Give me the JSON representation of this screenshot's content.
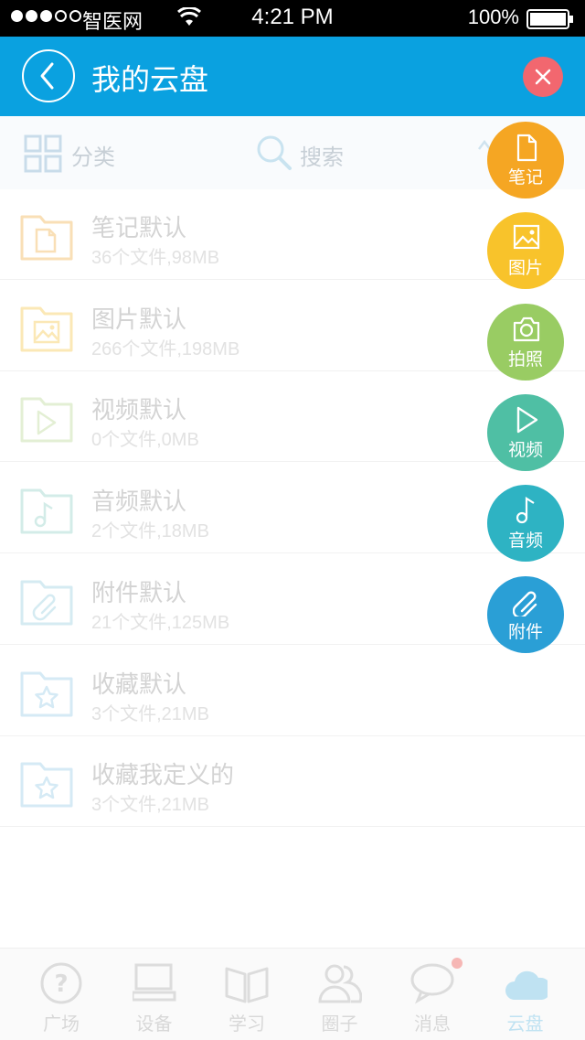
{
  "status_bar": {
    "carrier": "智医网",
    "time": "4:21 PM",
    "battery": "100%",
    "signal_bars_filled": 3,
    "signal_bars_total": 5
  },
  "header": {
    "title": "我的云盘",
    "back_icon": "chevron-left-icon",
    "close_icon": "close-icon",
    "background_color": "#0aa1e0",
    "close_color": "#f2676f"
  },
  "toolbar": {
    "category_label": "分类",
    "search_label": "搜索"
  },
  "folders": [
    {
      "name": "笔记默认",
      "meta": "36个文件,98MB",
      "icon": "note-folder-icon",
      "color": "#f9dfb6"
    },
    {
      "name": "图片默认",
      "meta": "266个文件,198MB",
      "icon": "image-folder-icon",
      "color": "#fbe8b6"
    },
    {
      "name": "视频默认",
      "meta": "0个文件,0MB",
      "icon": "video-folder-icon",
      "color": "#e3efd4"
    },
    {
      "name": "音频默认",
      "meta": "2个文件,18MB",
      "icon": "audio-folder-icon",
      "color": "#d3ece8"
    },
    {
      "name": "附件默认",
      "meta": "21个文件,125MB",
      "icon": "attachment-folder-icon",
      "color": "#d5ebf2"
    },
    {
      "name": "收藏默认",
      "meta": "3个文件,21MB",
      "icon": "star-folder-icon",
      "color": "#d5eaf5"
    },
    {
      "name": "收藏我定义的",
      "meta": "3个文件,21MB",
      "icon": "star-folder-icon",
      "color": "#d5eaf5"
    }
  ],
  "fab_menu": [
    {
      "label": "笔记",
      "icon": "note-icon",
      "color": "#f5a623"
    },
    {
      "label": "图片",
      "icon": "image-icon",
      "color": "#f8c32b"
    },
    {
      "label": "拍照",
      "icon": "camera-icon",
      "color": "#99cc63"
    },
    {
      "label": "视频",
      "icon": "play-icon",
      "color": "#4fbfa4"
    },
    {
      "label": "音频",
      "icon": "music-note-icon",
      "color": "#2eb3c3"
    },
    {
      "label": "附件",
      "icon": "paperclip-icon",
      "color": "#2a9fd6"
    }
  ],
  "tabbar": [
    {
      "label": "广场",
      "icon": "question-icon"
    },
    {
      "label": "设备",
      "icon": "device-icon"
    },
    {
      "label": "学习",
      "icon": "book-icon"
    },
    {
      "label": "圈子",
      "icon": "people-icon"
    },
    {
      "label": "消息",
      "icon": "chat-bubble-icon"
    },
    {
      "label": "云盘",
      "icon": "cloud-icon",
      "active": true
    }
  ]
}
